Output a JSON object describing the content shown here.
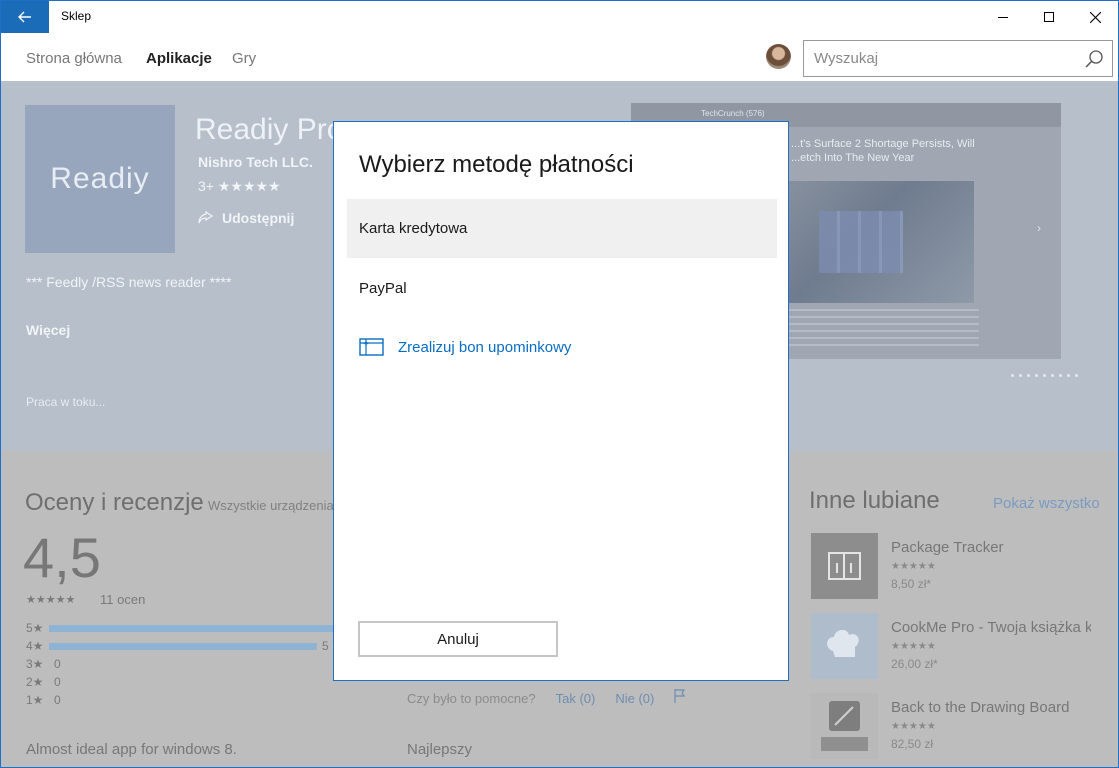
{
  "window": {
    "title": "Sklep"
  },
  "nav": {
    "tabs": [
      {
        "label": "Strona główna",
        "active": false
      },
      {
        "label": "Aplikacje",
        "active": true
      },
      {
        "label": "Gry",
        "active": false
      }
    ],
    "search_placeholder": "Wyszukaj"
  },
  "app": {
    "tile_text": "Readiy",
    "title": "Readiy Pro",
    "publisher": "Nishro Tech LLC.",
    "rating_line": "3+ ★★★★★",
    "share_label": "Udostępnij",
    "description": "*** Feedly /RSS news reader ****",
    "more_label": "Więcej",
    "progress_label": "Praca w toku...",
    "screenshot": {
      "tab_label": "TechCrunch (576)",
      "headline": "...t's Surface 2 Shortage Persists, Will ...etch Into The New Year",
      "dot_count": 9
    }
  },
  "reviews": {
    "title": "Oceny i recenzje",
    "filter_label": "Wszystkie urządzenia",
    "average": "4,5",
    "stars": "★★★★★",
    "count_label": "11 ocen",
    "rows": [
      {
        "label": "5★",
        "fraction": 1.0,
        "count": ""
      },
      {
        "label": "4★",
        "fraction": 0.45,
        "count": "5"
      },
      {
        "label": "3★",
        "fraction": 0,
        "count": "0"
      },
      {
        "label": "2★",
        "fraction": 0,
        "count": "0"
      },
      {
        "label": "1★",
        "fraction": 0,
        "count": "0"
      }
    ],
    "helpful_question": "Czy było to pomocne?",
    "helpful_yes": "Tak (0)",
    "helpful_no": "Nie (0)",
    "review1_title": "Almost ideal app for windows 8.",
    "review2_title": "Najlepszy"
  },
  "others": {
    "title": "Inne lubiane",
    "show_all": "Pokaż wszystko",
    "items": [
      {
        "name": "Package Tracker",
        "stars": "★★★★★",
        "price": "8,50 zł*"
      },
      {
        "name": "CookMe Pro - Twoja książka k",
        "stars": "★★★★★",
        "price": "26,00 zł*"
      },
      {
        "name": "Back to the Drawing Board",
        "stars": "★★★★★",
        "price": "82,50 zł"
      }
    ]
  },
  "dialog": {
    "title": "Wybierz metodę płatności",
    "options": [
      {
        "label": "Karta kredytowa",
        "selected": true
      },
      {
        "label": "PayPal",
        "selected": false
      }
    ],
    "redeem_label": "Zrealizuj bon upominkowy",
    "cancel_label": "Anuluj"
  },
  "colors": {
    "accent": "#1a6bb8",
    "link": "#0a6dc2",
    "overlay_hero": "#b6bfca",
    "overlay_lower": "#bdbdbd"
  }
}
